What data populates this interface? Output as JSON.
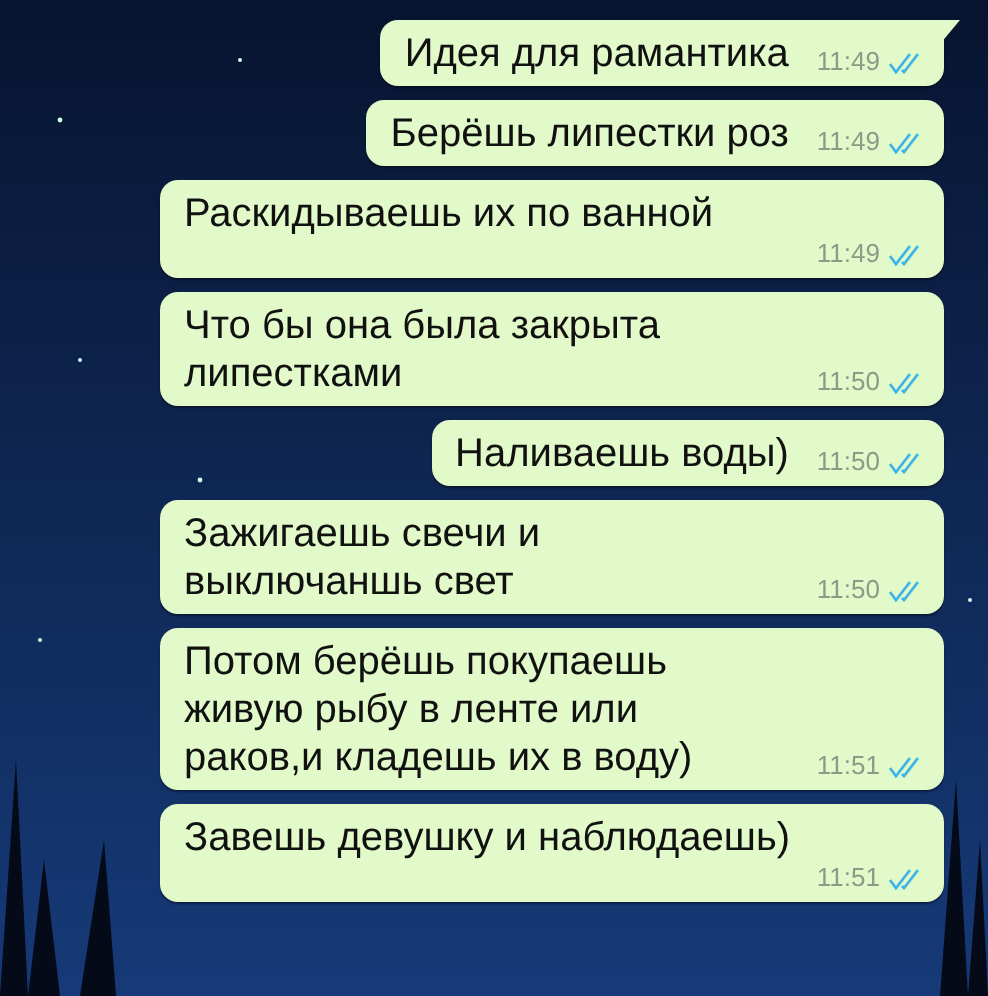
{
  "messages": [
    {
      "text": "Идея для рамантика",
      "time": "11:49",
      "read": true,
      "tail": true,
      "kind": "inline"
    },
    {
      "text": "Берёшь липестки роз",
      "time": "11:49",
      "read": true,
      "tail": false,
      "kind": "inline"
    },
    {
      "text": "Раскидываешь их по ванной",
      "time": "11:49",
      "read": true,
      "tail": false,
      "kind": "stacked"
    },
    {
      "text": "Что бы она была закрыта липестками",
      "time": "11:50",
      "read": true,
      "tail": false,
      "kind": "wrapped"
    },
    {
      "text": "Наливаешь воды)",
      "time": "11:50",
      "read": true,
      "tail": false,
      "kind": "inline"
    },
    {
      "text": "Зажигаешь свечи и выключаншь свет",
      "time": "11:50",
      "read": true,
      "tail": false,
      "kind": "wrapped"
    },
    {
      "text": "Потом берёшь покупаешь живую рыбу в ленте или раков,и кладешь их в воду)",
      "time": "11:51",
      "read": true,
      "tail": false,
      "kind": "wrapped"
    },
    {
      "text": "Завешь девушку и наблюдаешь)",
      "time": "11:51",
      "read": true,
      "tail": false,
      "kind": "stacked"
    }
  ]
}
